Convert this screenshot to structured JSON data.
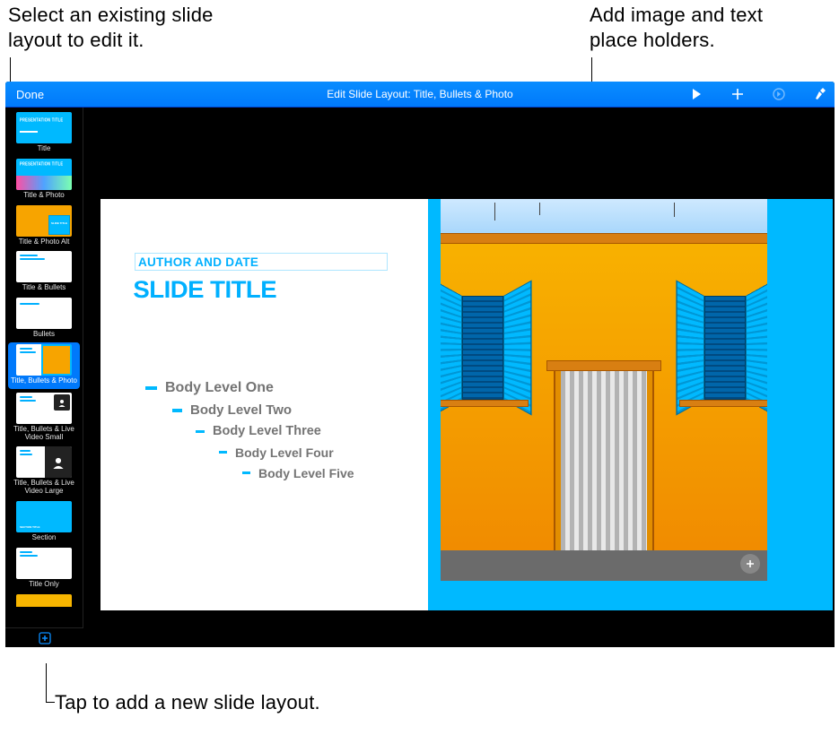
{
  "callouts": {
    "top_left": "Select an existing slide layout to edit it.",
    "top_right": "Add image and text place holders.",
    "bottom": "Tap to add a new slide layout."
  },
  "toolbar": {
    "done_label": "Done",
    "title": "Edit Slide Layout: Title, Bullets & Photo"
  },
  "sidebar": {
    "items": [
      {
        "label": "Title"
      },
      {
        "label": "Title & Photo"
      },
      {
        "label": "Title & Photo Alt"
      },
      {
        "label": "Title & Bullets"
      },
      {
        "label": "Bullets"
      },
      {
        "label": "Title, Bullets & Photo",
        "selected": true
      },
      {
        "label": "Title, Bullets & Live Video Small"
      },
      {
        "label": "Title, Bullets & Live Video Large"
      },
      {
        "label": "Section"
      },
      {
        "label": "Title Only"
      }
    ]
  },
  "slide": {
    "author_date": "AUTHOR AND DATE",
    "title": "SLIDE TITLE",
    "body_levels": [
      "Body Level One",
      "Body Level Two",
      "Body Level Three",
      "Body Level Four",
      "Body Level Five"
    ]
  },
  "icons": {
    "play": "play-icon",
    "plus": "plus-icon",
    "skip": "skip-icon",
    "brush": "format-brush-icon",
    "add_slide": "add-slide-icon",
    "media_plus": "media-plus-icon"
  }
}
